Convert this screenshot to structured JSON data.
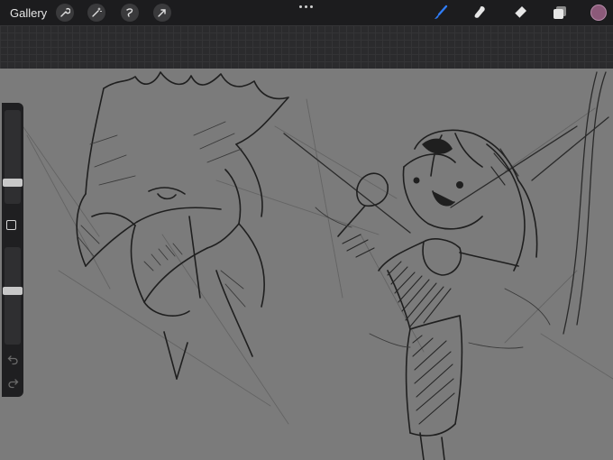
{
  "toolbar": {
    "gallery_label": "Gallery",
    "left_tools": [
      "wrench-icon",
      "magic-wand-icon",
      "selection-icon",
      "arrow-icon"
    ],
    "right_tools": [
      "brush-icon",
      "smudge-icon",
      "eraser-icon",
      "layers-icon"
    ],
    "active_tool": "brush-icon",
    "color": "#8c5a7a"
  },
  "sidebar": {
    "brush_size_level": 0.28,
    "opacity_level": 0.45,
    "buttons": [
      "modify-icon",
      "undo-icon",
      "redo-icon"
    ]
  },
  "canvas": {
    "content": "pencil-sketch"
  }
}
